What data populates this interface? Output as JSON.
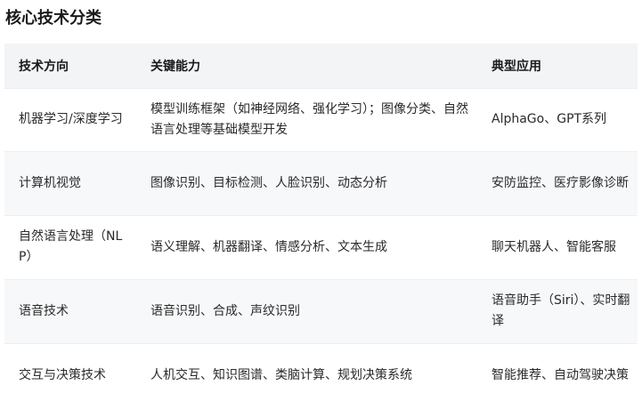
{
  "title": "核心技术分类",
  "table": {
    "headers": [
      "技术方向",
      "关键能力",
      "典型应用"
    ],
    "rows": [
      {
        "direction": "机器学习/深度学习",
        "capability": "模型训练框架（如神经网络、强化学习）；图像分类、自然语言处理等基础模型开发",
        "application": "AlphaGo、GPT系列"
      },
      {
        "direction": "计算机视觉",
        "capability": "图像识别、目标检测、人脸识别、动态分析",
        "application": "安防监控、医疗影像诊断"
      },
      {
        "direction": "自然语言处理（NLP）",
        "capability": "语义理解、机器翻译、情感分析、文本生成",
        "application": "聊天机器人、智能客服"
      },
      {
        "direction": "语音技术",
        "capability": "语音识别、合成、声纹识别",
        "application": "语音助手（Siri）、实时翻译"
      },
      {
        "direction": "交互与决策技术",
        "capability": "人机交互、知识图谱、类脑计算、规划决策系统",
        "application": "智能推荐、自动驾驶决策"
      }
    ]
  }
}
